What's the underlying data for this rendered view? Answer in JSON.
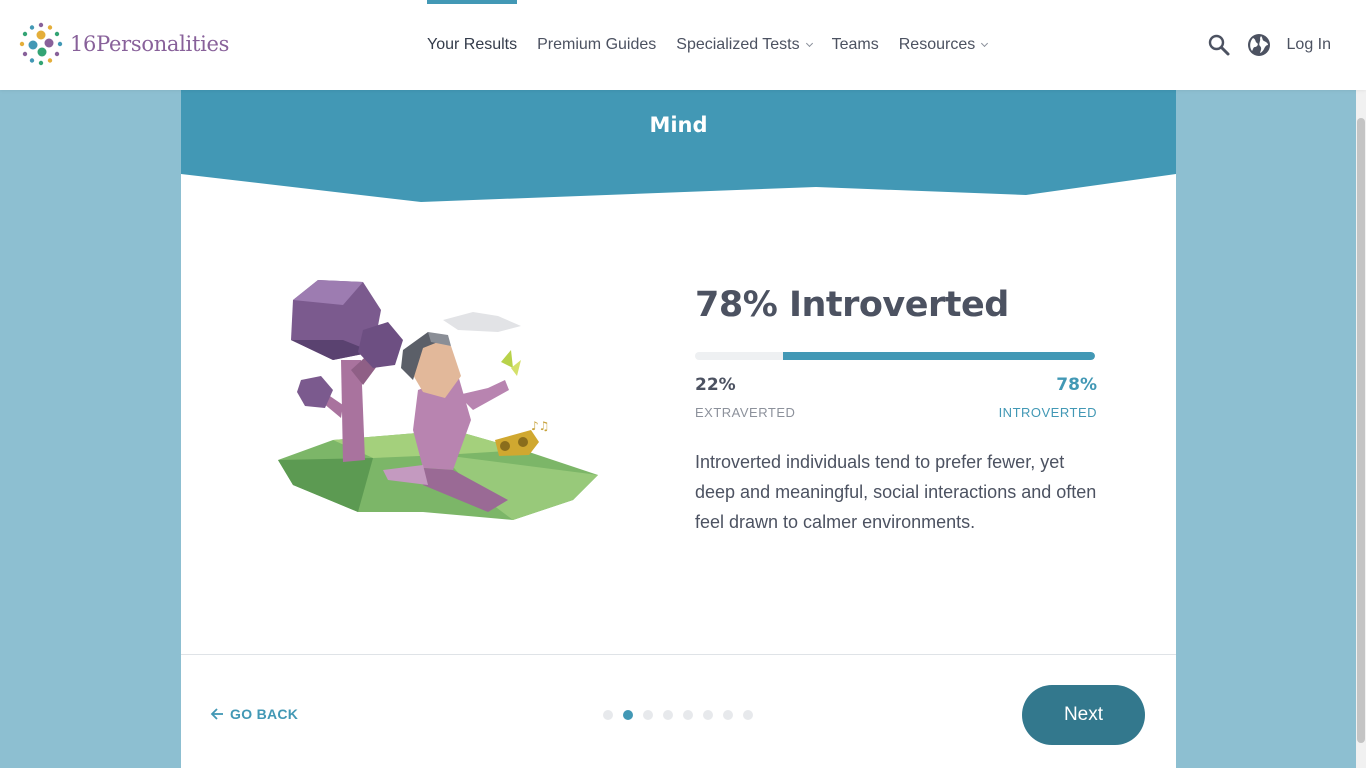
{
  "header": {
    "logo_number": "16",
    "logo_word": "Personalities",
    "nav": [
      {
        "label": "Your Results",
        "active": true,
        "dropdown": false
      },
      {
        "label": "Premium Guides",
        "active": false,
        "dropdown": false
      },
      {
        "label": "Specialized Tests",
        "active": false,
        "dropdown": true
      },
      {
        "label": "Teams",
        "active": false,
        "dropdown": false
      },
      {
        "label": "Resources",
        "active": false,
        "dropdown": true
      }
    ],
    "search_icon": "search-icon",
    "language_icon": "globe-icon",
    "login_label": "Log In"
  },
  "card": {
    "banner_title": "Mind",
    "result_title": "78% Introverted",
    "left_percent": "22%",
    "right_percent": "78%",
    "left_trait": "EXTRAVERTED",
    "right_trait": "INTROVERTED",
    "fill_fraction": 0.78,
    "description": "Introverted individuals tend to prefer fewer, yet deep and meaningful, social interactions and often feel drawn to calmer environments.",
    "go_back_label": "GO BACK",
    "next_label": "Next",
    "steps_total": 8,
    "step_current": 2
  },
  "colors": {
    "accent": "#4298b5",
    "accent_dark": "#33788d",
    "page_bg": "#8dbfd1",
    "text": "#4c5261",
    "brand_purple": "#88619a"
  }
}
